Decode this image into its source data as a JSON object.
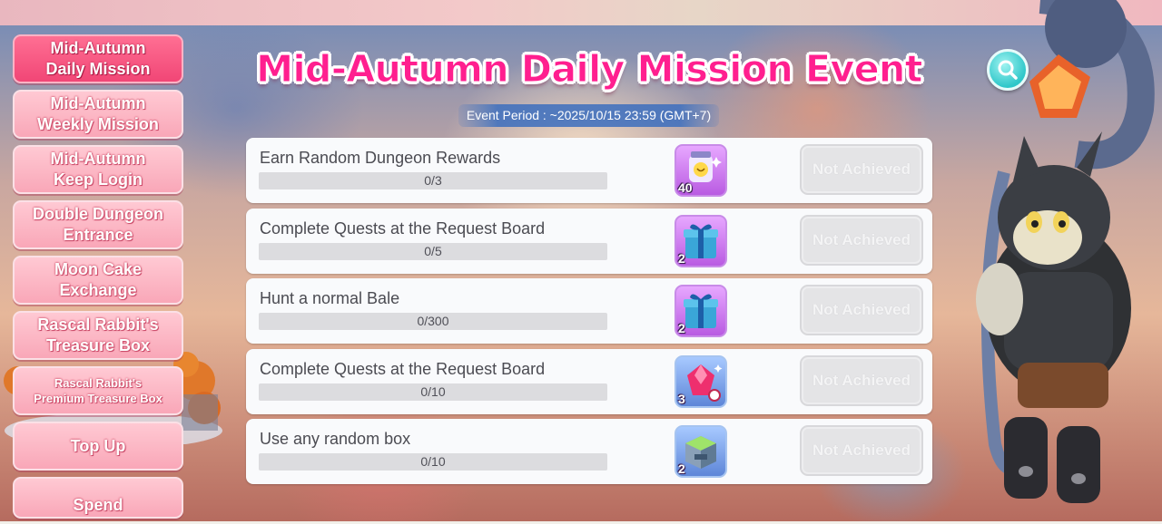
{
  "sidebar": {
    "items": [
      {
        "label": "Mid-Autumn\nDaily Mission",
        "active": true
      },
      {
        "label": "Mid-Autumn\nWeekly Mission",
        "active": false
      },
      {
        "label": "Mid-Autumn\nKeep Login",
        "active": false
      },
      {
        "label": "Double Dungeon\nEntrance",
        "active": false
      },
      {
        "label": "Moon Cake\nExchange",
        "active": false
      },
      {
        "label": "Rascal Rabbit's\nTreasure Box",
        "active": false
      },
      {
        "label": "Rascal Rabbit's\nPremium Treasure Box",
        "active": false
      },
      {
        "label": "Top Up",
        "active": false
      },
      {
        "label": "Spend",
        "active": false
      }
    ]
  },
  "header": {
    "title": "Mid-Autumn Daily Mission Event",
    "event_period": "Event Period : ~2025/10/15 23:59 (GMT+7)",
    "search_icon": "search-icon"
  },
  "missions": [
    {
      "name": "Earn Random Dungeon Rewards",
      "progress": "0/3",
      "progress_fraction": 0,
      "reward_icon": "random-reward-jar-icon",
      "reward_qty": "40",
      "status": "Not Achieved"
    },
    {
      "name": "Complete Quests at the Request Board",
      "progress": "0/5",
      "progress_fraction": 0,
      "reward_icon": "blue-gift-box-icon",
      "reward_qty": "2",
      "status": "Not Achieved"
    },
    {
      "name": "Hunt a normal Bale",
      "progress": "0/300",
      "progress_fraction": 0,
      "reward_icon": "blue-gift-box-icon",
      "reward_qty": "2",
      "status": "Not Achieved"
    },
    {
      "name": "Complete Quests at the Request Board",
      "progress": "0/10",
      "progress_fraction": 0,
      "reward_icon": "pink-gem-icon",
      "reward_qty": "3",
      "status": "Not Achieved"
    },
    {
      "name": "Use any random box",
      "progress": "0/10",
      "progress_fraction": 0,
      "reward_icon": "green-cube-box-icon",
      "reward_qty": "2",
      "status": "Not Achieved"
    }
  ],
  "colors": {
    "title": "#ff1f8f",
    "active_tab": "#f14676",
    "inactive_tab": "#f9a7b8",
    "not_achieved": "#e4e4e6"
  }
}
